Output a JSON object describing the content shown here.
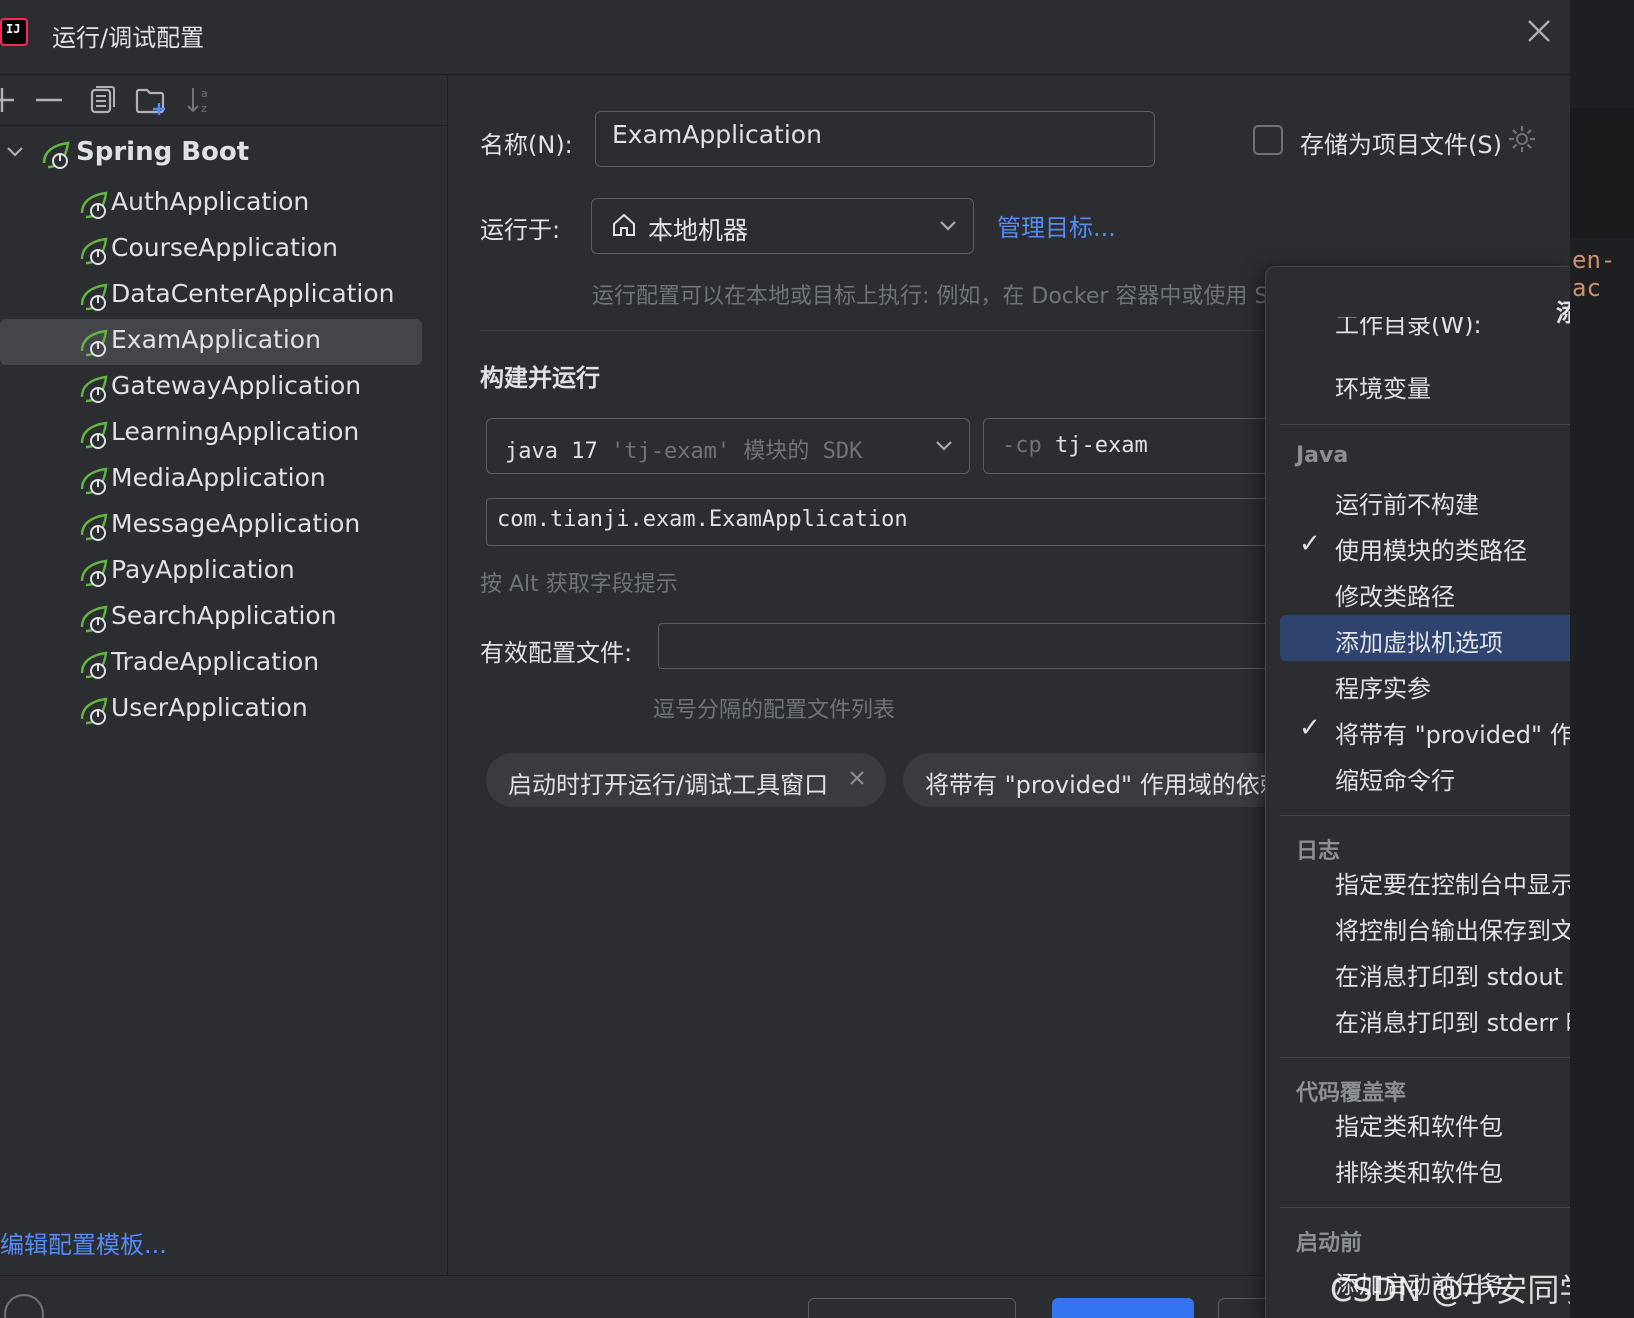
{
  "window": {
    "title": "运行/调试配置"
  },
  "toolbar": {
    "add_icon": "plus-icon",
    "remove_icon": "minus-icon",
    "copy_icon": "copy-icon",
    "folder_icon": "new-folder-icon",
    "sort_icon": "sort-alpha-icon"
  },
  "tree": {
    "root_label": "Spring Boot",
    "items": [
      {
        "label": "AuthApplication"
      },
      {
        "label": "CourseApplication"
      },
      {
        "label": "DataCenterApplication"
      },
      {
        "label": "ExamApplication",
        "selected": true
      },
      {
        "label": "GatewayApplication"
      },
      {
        "label": "LearningApplication"
      },
      {
        "label": "MediaApplication"
      },
      {
        "label": "MessageApplication"
      },
      {
        "label": "PayApplication"
      },
      {
        "label": "SearchApplication"
      },
      {
        "label": "TradeApplication"
      },
      {
        "label": "UserApplication"
      }
    ],
    "edit_templates_link": "编辑配置模板..."
  },
  "form": {
    "name_label": "名称(N):",
    "name_value": "ExamApplication",
    "store_as_project_file_label": "存储为项目文件(S)",
    "run_on_label": "运行于:",
    "run_on_value": "本地机器",
    "manage_targets_link": "管理目标...",
    "run_on_hint": "运行配置可以在本地或目标上执行: 例如，在 Docker 容器中或使用 S",
    "build_and_run_heading": "构建并运行",
    "jdk_value_prefix": "java 17",
    "jdk_value_suffix": "'tj-exam' 模块的 SDK",
    "cp_prefix": "-cp",
    "cp_value": "tj-exam",
    "main_class_value": "com.tianji.exam.ExamApplication",
    "alt_hint": "按 Alt 获取字段提示",
    "active_profiles_label": "有效配置文件:",
    "active_profiles_value": "",
    "profiles_hint": "逗号分隔的配置文件列表",
    "chips": [
      {
        "label": "启动时打开运行/调试工具窗口"
      },
      {
        "label": "将带有 \"provided\" 作用域的依赖"
      }
    ]
  },
  "popup": {
    "title": "添加运行",
    "top_items": [
      "工作目录(W):",
      "环境变量"
    ],
    "groups": [
      {
        "name": "Java",
        "items": [
          {
            "label": "运行前不构建",
            "checked": false
          },
          {
            "label": "使用模块的类路径",
            "checked": true
          },
          {
            "label": "修改类路径",
            "checked": false
          },
          {
            "label": "添加虚拟机选项",
            "checked": false,
            "highlighted": true
          },
          {
            "label": "程序实参",
            "checked": false
          },
          {
            "label": "将带有 \"provided\" 作用域的",
            "checked": true
          },
          {
            "label": "缩短命令行",
            "checked": false
          }
        ]
      },
      {
        "name": "日志",
        "items": [
          {
            "label": "指定要在控制台中显示的日志"
          },
          {
            "label": "将控制台输出保存到文件"
          },
          {
            "label": "在消息打印到 stdout 时显示"
          },
          {
            "label": "在消息打印到 stderr 时显示"
          }
        ]
      },
      {
        "name": "代码覆盖率",
        "items": [
          {
            "label": "指定类和软件包"
          },
          {
            "label": "排除类和软件包"
          }
        ]
      },
      {
        "name": "启动前",
        "items": [
          {
            "label": "添加启动前任务"
          }
        ]
      }
    ]
  },
  "watermark": "CSDN @小安同学iter",
  "right_edge_text": "en-ac",
  "colors": {
    "background": "#2b2d30",
    "selection": "#43454a",
    "highlight": "#2e436e",
    "link": "#548af7",
    "spring_green": "#62b543",
    "primary_button": "#3574f0"
  }
}
